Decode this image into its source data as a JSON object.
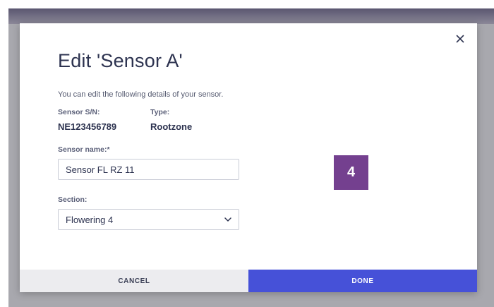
{
  "modal": {
    "title": "Edit 'Sensor A'",
    "description": "You can edit the following details of your sensor.",
    "close_icon": "close-icon"
  },
  "sensor": {
    "serial_label": "Sensor S/N:",
    "serial_value": "NE123456789",
    "type_label": "Type:",
    "type_value": "Rootzone"
  },
  "form": {
    "name_label": "Sensor name:*",
    "name_value": "Sensor FL RZ 11",
    "section_label": "Section:",
    "section_value": "Flowering 4",
    "section_icon": "chevron-down-icon"
  },
  "badge": {
    "value": "4",
    "color": "#74408f"
  },
  "footer": {
    "cancel_label": "CANCEL",
    "done_label": "DONE",
    "done_color": "#4651d8",
    "cancel_color": "#ececef"
  }
}
